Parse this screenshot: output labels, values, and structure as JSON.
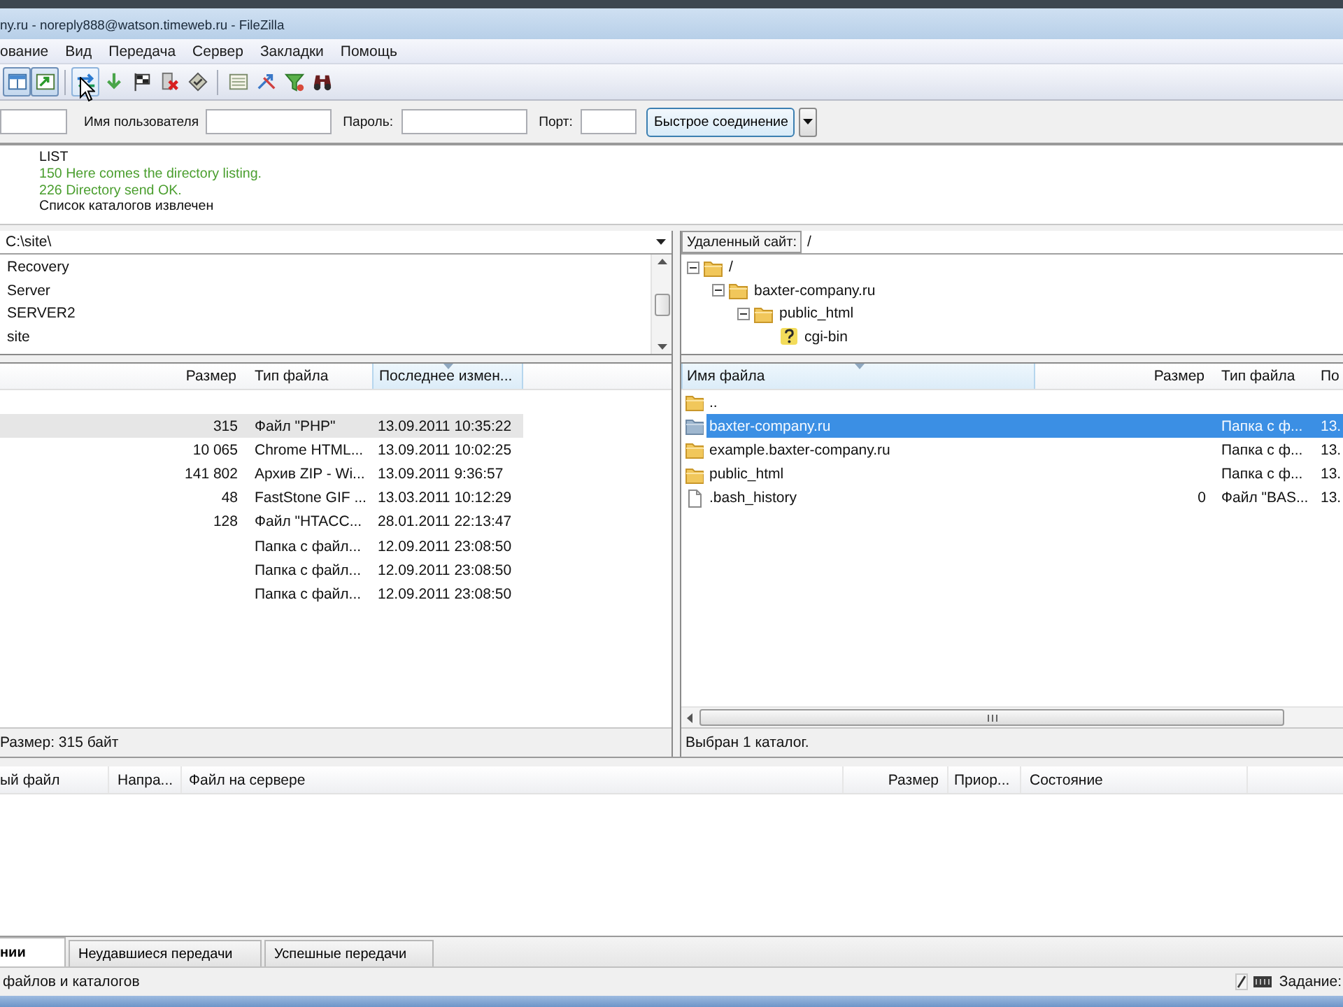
{
  "window": {
    "title": "ny.ru - noreply888@watson.timeweb.ru - FileZilla"
  },
  "menu": [
    "ование",
    "Вид",
    "Передача",
    "Сервер",
    "Закладки",
    "Помощь"
  ],
  "toolbar": [
    {
      "buttons": [
        {
          "pressed": true,
          "hovered": false
        },
        {
          "pressed": true,
          "hovered": false
        }
      ]
    },
    {
      "buttons": [
        {
          "pressed": false,
          "hovered": true
        },
        {
          "pressed": false,
          "hovered": false
        },
        {
          "pressed": false,
          "hovered": false
        },
        {
          "pressed": false,
          "hovered": false
        },
        {
          "pressed": false,
          "hovered": false
        }
      ]
    },
    {
      "buttons": [
        {
          "pressed": false,
          "hovered": false
        },
        {
          "pressed": false,
          "hovered": false
        },
        {
          "pressed": false,
          "hovered": false
        },
        {
          "pressed": false,
          "hovered": false
        }
      ]
    }
  ],
  "quickconnect": {
    "fields": [
      {
        "label": "Имя пользователя"
      },
      {
        "label": "Пароль:"
      },
      {
        "label": "Порт:"
      }
    ],
    "button": "Быстрое соединение"
  },
  "message_log": [
    {
      "kind": "command",
      "text": "LIST"
    },
    {
      "kind": "response",
      "text": "150 Here comes the directory listing."
    },
    {
      "kind": "response",
      "text": "226 Directory send OK."
    },
    {
      "kind": "status",
      "text": "Список каталогов извлечен"
    }
  ],
  "local_site": {
    "path": "C:\\site\\",
    "tree": [
      {
        "label": "Recovery"
      },
      {
        "label": "Server"
      },
      {
        "label": "SERVER2"
      },
      {
        "label": "site"
      }
    ],
    "columns": [
      {
        "label": "Размер",
        "sorted": false
      },
      {
        "label": "Тип файла",
        "sorted": false
      },
      {
        "label": "Последнее измен...",
        "sorted": true
      }
    ],
    "rows": [
      {
        "size": "315",
        "type": "Файл \"PHP\"",
        "modified": "13.09.2011 10:35:22",
        "selected": true
      },
      {
        "size": "10 065",
        "type": "Chrome HTML...",
        "modified": "13.09.2011 10:02:25",
        "selected": false
      },
      {
        "size": "141 802",
        "type": "Архив ZIP - Wi...",
        "modified": "13.09.2011 9:36:57",
        "selected": false
      },
      {
        "size": "48",
        "type": "FastStone GIF ...",
        "modified": "13.03.2011 10:12:29",
        "selected": false
      },
      {
        "size": "128",
        "type": "Файл \"HTACC...",
        "modified": "28.01.2011 22:13:47",
        "selected": false
      },
      {
        "type": "Папка с файл...",
        "modified": "12.09.2011 23:08:50",
        "selected": false
      },
      {
        "type": "Папка с файл...",
        "modified": "12.09.2011 23:08:50",
        "selected": false
      },
      {
        "type": "Папка с файл...",
        "modified": "12.09.2011 23:08:50",
        "selected": false
      }
    ],
    "status": "Размер: 315 байт"
  },
  "remote_site": {
    "label": "Удаленный сайт:",
    "path": "/",
    "tree": [
      {
        "label": "/",
        "kind": "folder",
        "expanded": true,
        "children": [
          {
            "label": "baxter-company.ru",
            "kind": "folder",
            "expanded": true,
            "children": [
              {
                "label": "public_html",
                "kind": "folder",
                "expanded": true,
                "children": [
                  {
                    "label": "cgi-bin",
                    "kind": "unknown"
                  }
                ]
              }
            ]
          }
        ]
      }
    ],
    "columns": [
      {
        "label": "Имя файла",
        "sorted": true
      },
      {
        "label": "Размер",
        "sorted": false
      },
      {
        "label": "Тип файла",
        "sorted": false
      },
      {
        "label": "По",
        "sorted": false
      }
    ],
    "rows": [
      {
        "kind": "folder",
        "name": "..",
        "selected": false
      },
      {
        "kind": "folder",
        "name": "baxter-company.ru",
        "type": "Папка с ф...",
        "modified": "13.",
        "selected": true
      },
      {
        "kind": "folder",
        "name": "example.baxter-company.ru",
        "type": "Папка с ф...",
        "modified": "13.",
        "selected": false
      },
      {
        "kind": "folder",
        "name": "public_html",
        "type": "Папка с ф...",
        "modified": "13.",
        "selected": false
      },
      {
        "kind": "file",
        "name": ".bash_history",
        "size": "0",
        "type": "Файл \"BAS...",
        "modified": "13.",
        "selected": false
      }
    ],
    "status": "Выбран 1 каталог."
  },
  "queue": {
    "columns": [
      "ый файл",
      "Напра...",
      "Файл на сервере",
      "Размер",
      "Приор...",
      "Состояние"
    ],
    "tabs": [
      {
        "label": "нии",
        "selected": true
      },
      {
        "label": "Неудавшиеся передачи",
        "selected": false
      },
      {
        "label": "Успешные передачи",
        "selected": false
      }
    ]
  },
  "status_bar": {
    "text": "файлов и каталогов",
    "queue_label": "Задание:"
  }
}
